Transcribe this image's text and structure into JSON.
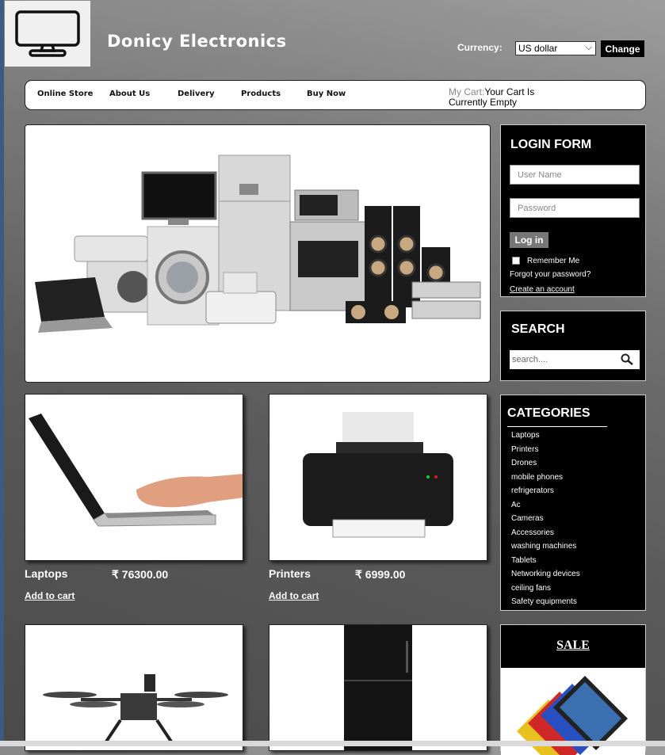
{
  "header": {
    "site_title": "Donicy Electronics",
    "logo_icon": "monitor-icon",
    "currency_label": "Currency:",
    "currency_value": "US dollar",
    "change_label": "Change"
  },
  "nav": {
    "items": [
      "Online Store",
      "About Us",
      "Delivery",
      "Products",
      "Buy Now"
    ],
    "cart_label": "My Cart:",
    "cart_status": "Your Cart Is Currently Empty"
  },
  "login": {
    "title": "LOGIN FORM",
    "username_placeholder": "User Name",
    "password_placeholder": "Password",
    "login_label": "Log in",
    "remember_label": "Remember Me",
    "forgot_label": "Forgot your password?",
    "create_label": "Create an account"
  },
  "search": {
    "title": "SEARCH",
    "placeholder": "search....",
    "icon": "search-icon"
  },
  "categories": {
    "title": "CATEGORIES",
    "items": [
      "Laptops",
      "Printers",
      "Drones",
      "mobile phones",
      "refrigerators",
      "Ac",
      "Cameras",
      "Accessories",
      "washing machines",
      "Tablets",
      "Networking devices",
      "ceiling fans",
      "Safety equipments"
    ]
  },
  "products": [
    {
      "name": "Laptops",
      "price": "₹ 76300.00",
      "cart_label": "Add to cart"
    },
    {
      "name": "Printers",
      "price": "₹ 6999.00",
      "cart_label": "Add to cart"
    }
  ],
  "sale": {
    "title": "SALE"
  }
}
